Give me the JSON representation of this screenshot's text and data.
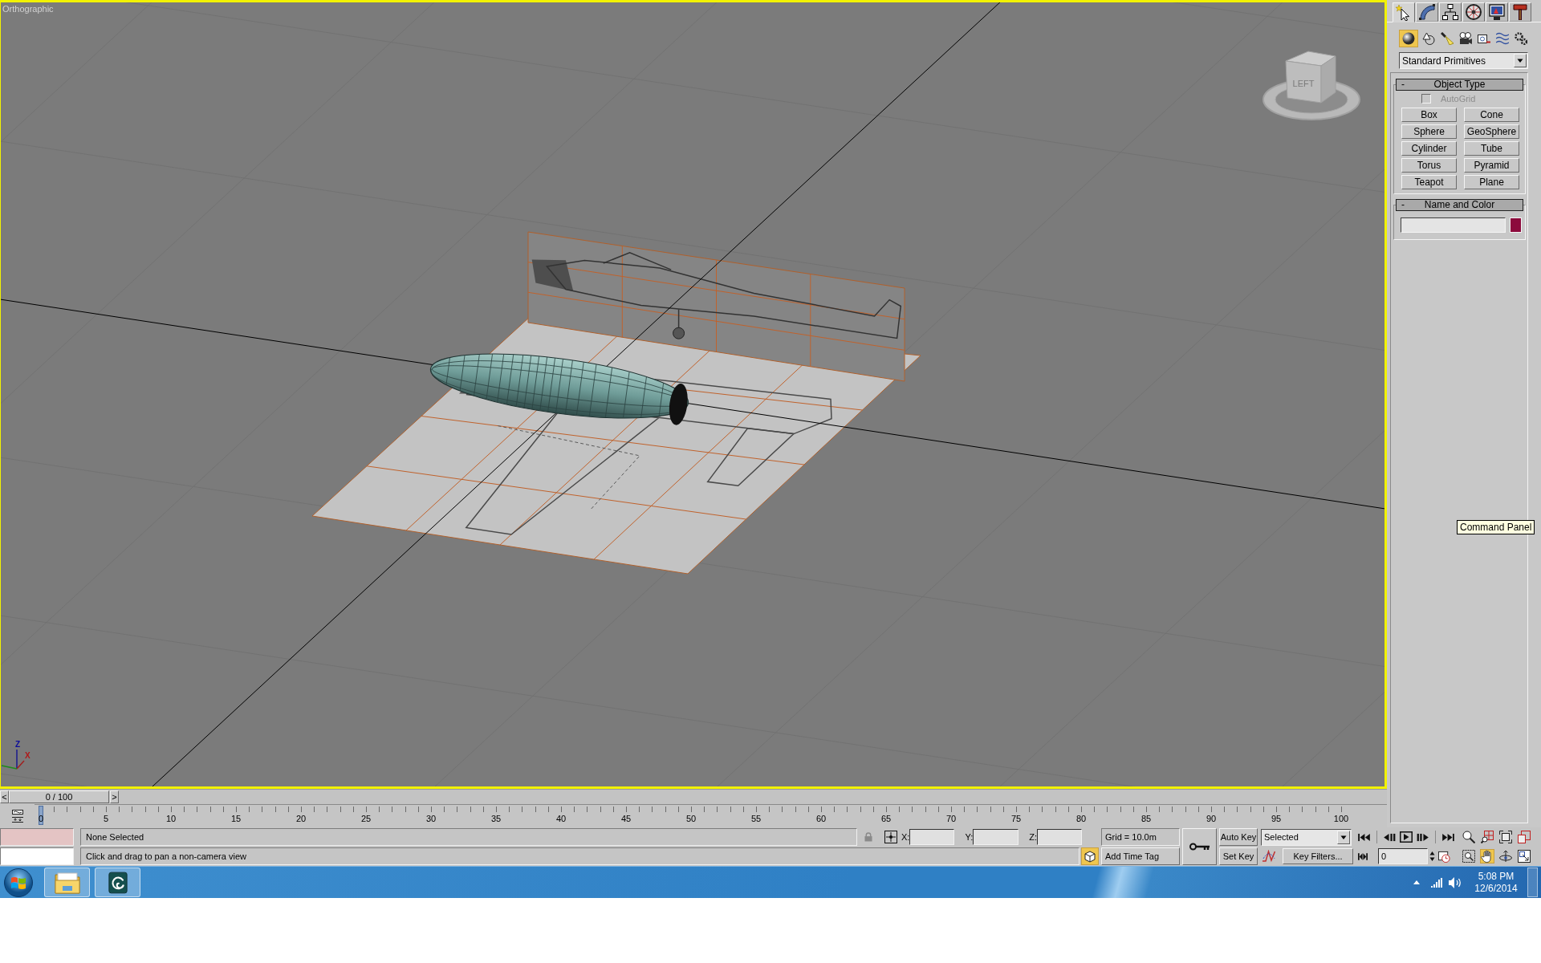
{
  "viewport": {
    "label": "Orthographic",
    "viewcube_face": "LEFT",
    "axis_labels": [
      "Z",
      "X"
    ]
  },
  "command_panel": {
    "tabs": [
      {
        "kind": "create",
        "selected": true
      },
      {
        "kind": "modify",
        "selected": false
      },
      {
        "kind": "hierarchy",
        "selected": false
      },
      {
        "kind": "motion",
        "selected": false
      },
      {
        "kind": "display",
        "selected": false
      },
      {
        "kind": "utilities",
        "selected": false
      }
    ],
    "categories": [
      {
        "kind": "geometry",
        "selected": true
      },
      {
        "kind": "shapes",
        "selected": false
      },
      {
        "kind": "lights",
        "selected": false
      },
      {
        "kind": "cameras",
        "selected": false
      },
      {
        "kind": "helpers",
        "selected": false
      },
      {
        "kind": "space_warps",
        "selected": false
      },
      {
        "kind": "systems",
        "selected": false
      }
    ],
    "dropdown": "Standard Primitives",
    "rollouts": [
      {
        "kind": "object_type",
        "toggle": "-",
        "title": "Object Type",
        "autogrid": {
          "label": "AutoGrid",
          "checked": false,
          "disabled": true
        },
        "buttons": [
          "Box",
          "Cone",
          "Sphere",
          "GeoSphere",
          "Cylinder",
          "Tube",
          "Torus",
          "Pyramid",
          "Teapot",
          "Plane"
        ]
      },
      {
        "kind": "name_color",
        "toggle": "-",
        "title": "Name and Color",
        "color": "#8c0a3c"
      }
    ],
    "tooltip": "Command Panel"
  },
  "time_slider": {
    "prev": "<",
    "label": "0 / 100",
    "next": ">",
    "level": 0
  },
  "track_bar": {
    "labels": [
      "0",
      "5",
      "10",
      "15",
      "20",
      "25",
      "30",
      "35",
      "40",
      "45",
      "50",
      "55",
      "60",
      "65",
      "70",
      "75",
      "80",
      "85",
      "90",
      "95",
      "100"
    ]
  },
  "status_bar": {
    "selection": "None Selected",
    "prompt": "Click and drag to pan a non-camera view",
    "coordinates": [
      "X:",
      "Y:",
      "Z:"
    ],
    "grid": "Grid = 10.0m",
    "add_time_tag": "Add Time Tag"
  },
  "animation": {
    "auto_key": "Auto Key",
    "set_key": "Set Key",
    "key_mode": "Selected",
    "key_filters": "Key Filters...",
    "playback": [
      {
        "kind": "go_start"
      },
      {
        "kind": "previous"
      },
      {
        "kind": "play"
      },
      {
        "kind": "next"
      },
      {
        "kind": "go_end"
      }
    ],
    "frame": "0"
  },
  "navigation": [
    {
      "kind": "zoom",
      "selected": false
    },
    {
      "kind": "zoom_all",
      "selected": false
    },
    {
      "kind": "zoom_extents",
      "selected": false
    },
    {
      "kind": "zoom_extents_all",
      "selected": false
    },
    {
      "kind": "region_zoom",
      "selected": false
    },
    {
      "kind": "pan",
      "selected": true
    },
    {
      "kind": "orbit",
      "selected": false
    },
    {
      "kind": "maximize",
      "selected": false
    }
  ],
  "taskbar": {
    "apps": [
      {
        "kind": "folder"
      },
      {
        "kind": "app_tile"
      }
    ],
    "time": "5:08 PM",
    "date": "12/6/2014"
  }
}
